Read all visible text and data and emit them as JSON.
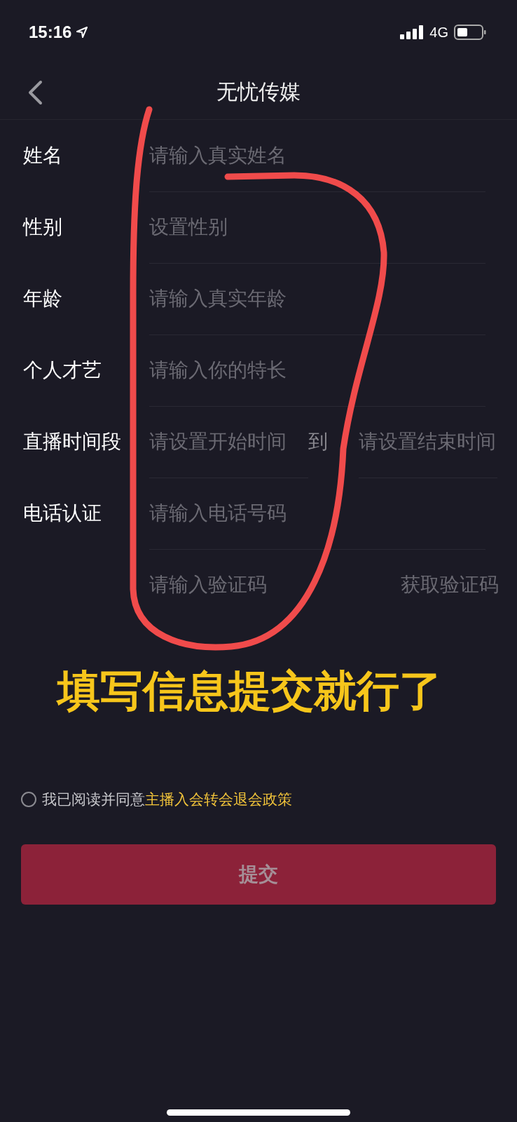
{
  "status_bar": {
    "time": "15:16",
    "network": "4G"
  },
  "nav": {
    "title": "无忧传媒"
  },
  "form": [
    {
      "kind": "text",
      "label": "姓名",
      "placeholder": "请输入真实姓名"
    },
    {
      "kind": "text",
      "label": "性别",
      "placeholder": "设置性别"
    },
    {
      "kind": "text",
      "label": "年龄",
      "placeholder": "请输入真实年龄"
    },
    {
      "kind": "text",
      "label": "个人才艺",
      "placeholder": "请输入你的特长"
    },
    {
      "kind": "range",
      "label": "直播时间段",
      "placeholder": "请设置开始时间",
      "separator": "到",
      "placeholder_end": "请设置结束时间"
    },
    {
      "kind": "text",
      "label": "电话认证",
      "placeholder": "请输入电话号码"
    },
    {
      "kind": "code",
      "placeholder": "请输入验证码",
      "action": "获取验证码"
    }
  ],
  "annotation": {
    "text": "填写信息提交就行了"
  },
  "agreement": {
    "agreed": false,
    "text": "我已阅读并同意",
    "link": "主播入会转会退会政策"
  },
  "submit": {
    "label": "提交"
  }
}
